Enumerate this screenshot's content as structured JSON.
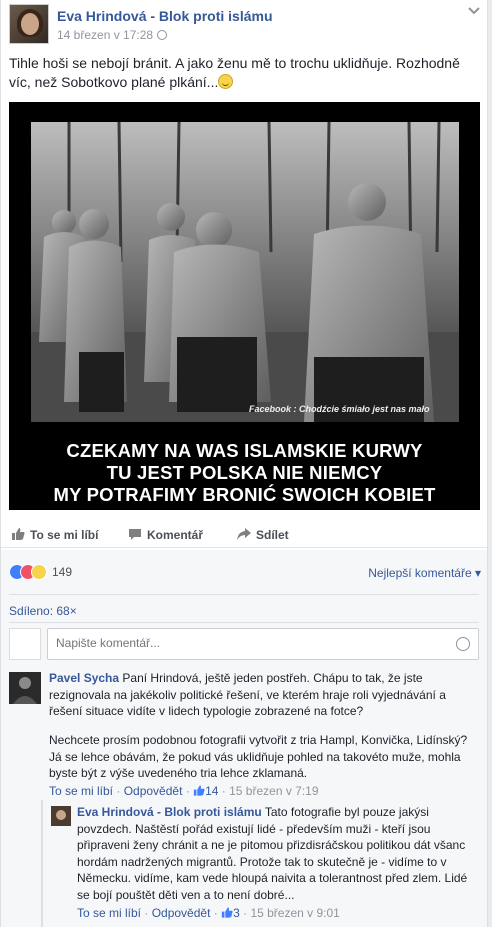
{
  "post": {
    "author": "Eva Hrindová - Blok proti islámu",
    "timestamp": "14 březen v 17:28",
    "text": "Tihle hoši se nebojí bránit. A jako ženu mě to trochu uklidňuje. Rozhodně víc, než Sobotkovo plané plkání...",
    "image": {
      "watermark": "Facebook : Chodźcie śmiało jest nas mało",
      "caption_lines": [
        "CZEKAMY NA WAS ISLAMSKIE KURWY",
        "TU JEST POLSKA NIE NIEMCY",
        "MY POTRAFIMY BRONIĆ SWOICH KOBIET"
      ]
    }
  },
  "actions": {
    "like": "To se mi líbí",
    "comment": "Komentář",
    "share": "Sdílet"
  },
  "reactions": {
    "count": "149",
    "icons": [
      "like",
      "love",
      "haha"
    ],
    "sort_label": "Nejlepší komentáře"
  },
  "shared_label": "Sdíleno: 68×",
  "comment_input": {
    "placeholder": "Napište komentář..."
  },
  "comments": [
    {
      "author": "Pavel Sycha",
      "text_p1": "Paní Hrindová, ještě jeden postřeh. Chápu to tak, že jste rezignovala na jakékoliv politické řešení, ve kterém hraje roli vyjednávání a řešení situace vidíte v lidech typologie zobrazené na fotce?",
      "text_p2": "Nechcete prosím podobnou fotografii vytvořit z tria Hampl, Konvička, Lidínský? Já se lehce obávám, že pokud vás uklidňuje pohled na takovéto muže, mohla byste být z výše uvedeného tria lehce zklamaná.",
      "like_label": "To se mi líbí",
      "reply_label": "Odpovědět",
      "likes": "14",
      "time": "15 březen v 7:19"
    },
    {
      "author": "Eva Hrindová - Blok proti islámu",
      "text": "Tato fotografie byl pouze jakýsi povzdech. Naštěstí pořád existují lidé - především muži - kteří jsou připraveni ženy chránit a ne je pitomou přizdisráčskou politikou dát všanc hordám nadržených migrantů. Protože tak to skutečně je - vidíme to v Německu. vidíme, kam vede hloupá naivita a tolerantnost před zlem. Lidé se bojí pouštět děti ven a to není dobré...",
      "like_label": "To se mi líbí",
      "reply_label": "Odpovědět",
      "likes": "3",
      "time": "15 březen v 9:01"
    }
  ],
  "colors": {
    "link": "#365899",
    "meta": "#90949c",
    "like_blue": "#4080ff"
  }
}
